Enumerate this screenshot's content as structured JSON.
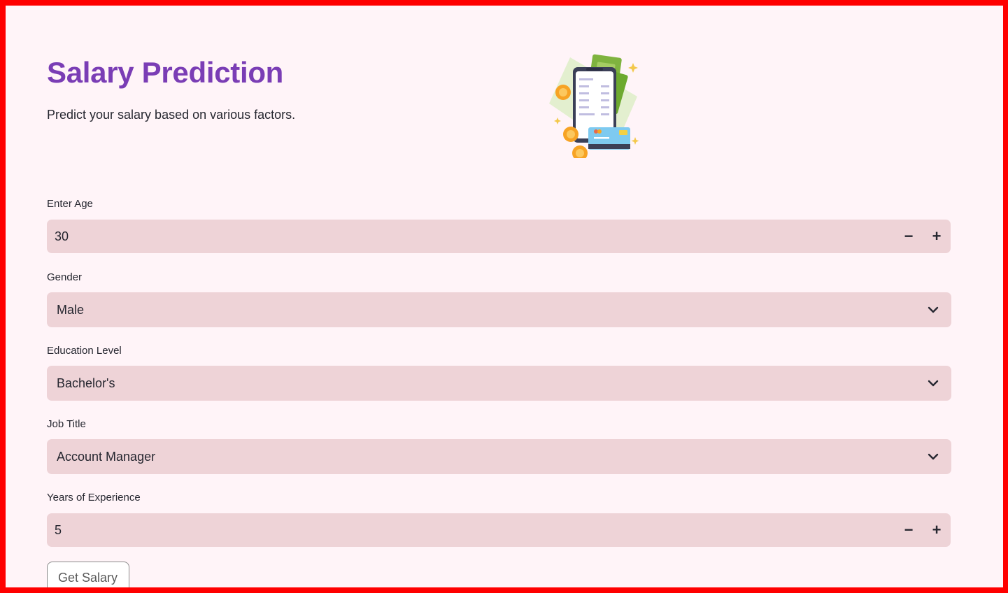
{
  "header": {
    "title": "Salary Prediction",
    "subtitle": "Predict your salary based on various factors."
  },
  "hero": {
    "icon": "mobile-payment-money-illustration"
  },
  "form": {
    "age": {
      "label": "Enter Age",
      "value": "30",
      "decrement": "−",
      "increment": "+"
    },
    "gender": {
      "label": "Gender",
      "selected": "Male"
    },
    "education": {
      "label": "Education Level",
      "selected": "Bachelor's"
    },
    "job_title": {
      "label": "Job Title",
      "selected": "Account Manager"
    },
    "experience": {
      "label": "Years of Experience",
      "value": "5",
      "decrement": "−",
      "increment": "+"
    },
    "submit_label": "Get Salary"
  },
  "colors": {
    "frame": "#ff0000",
    "background": "#fff4f8",
    "accent": "#7a3db5",
    "input_bg": "#eed3d7"
  }
}
